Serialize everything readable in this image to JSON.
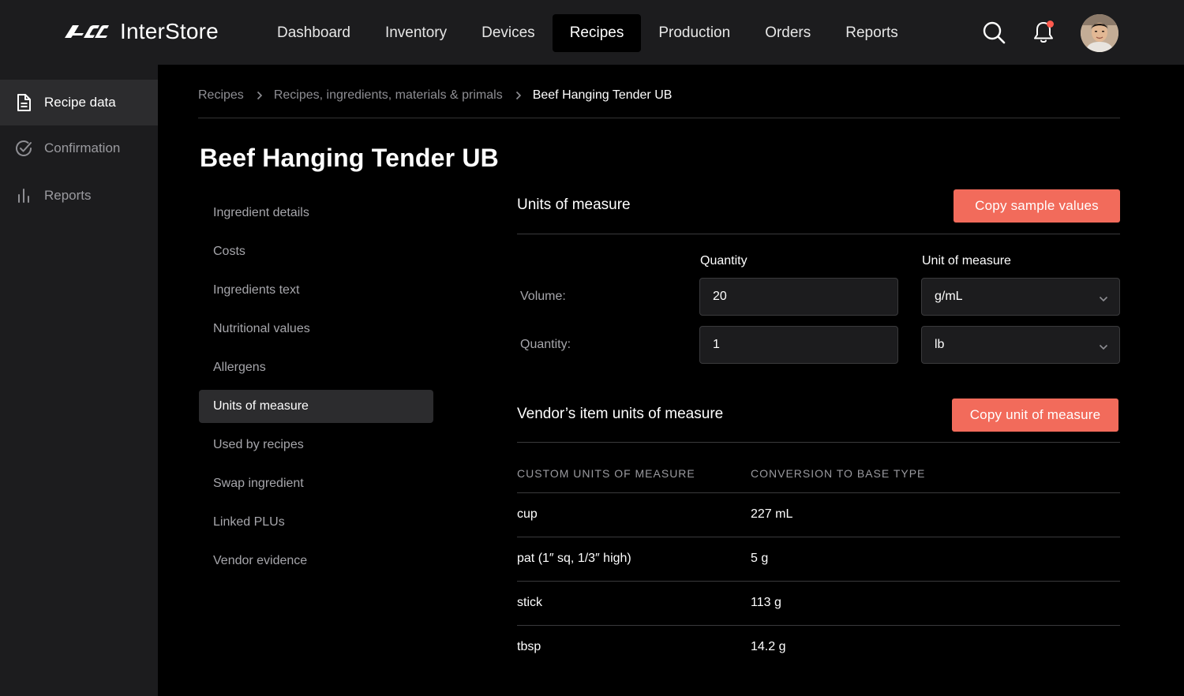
{
  "app": {
    "name": "InterStore"
  },
  "nav": {
    "items": [
      {
        "label": "Dashboard"
      },
      {
        "label": "Inventory"
      },
      {
        "label": "Devices"
      },
      {
        "label": "Recipes"
      },
      {
        "label": "Production"
      },
      {
        "label": "Orders"
      },
      {
        "label": "Reports"
      }
    ],
    "active": "Recipes"
  },
  "header_icons": [
    "search-icon",
    "bell-icon",
    "avatar"
  ],
  "sidebar": {
    "items": [
      {
        "label": "Recipe data",
        "icon": "document-icon"
      },
      {
        "label": "Confirmation",
        "icon": "check-circle-icon"
      },
      {
        "label": "Reports",
        "icon": "bar-chart-icon"
      }
    ],
    "active": "Recipe data"
  },
  "breadcrumb": {
    "items": [
      "Recipes",
      "Recipes, ingredients, materials & primals",
      "Beef Hanging Tender UB"
    ]
  },
  "page": {
    "title": "Beef Hanging Tender UB"
  },
  "subnav": {
    "items": [
      {
        "label": "Ingredient details"
      },
      {
        "label": "Costs"
      },
      {
        "label": "Ingredients text"
      },
      {
        "label": "Nutritional values"
      },
      {
        "label": "Allergens"
      },
      {
        "label": "Units of measure"
      },
      {
        "label": "Used by recipes"
      },
      {
        "label": "Swap ingredient"
      },
      {
        "label": "Linked PLUs"
      },
      {
        "label": "Vendor evidence"
      }
    ],
    "active": "Units of measure"
  },
  "units": {
    "title": "Units of measure",
    "copy_button": "Copy sample values",
    "col_quantity": "Quantity",
    "col_unit": "Unit of measure",
    "rows": [
      {
        "label": "Volume:",
        "quantity": "20",
        "unit": "g/mL"
      },
      {
        "label": "Quantity:",
        "quantity": "1",
        "unit": "lb"
      }
    ]
  },
  "vendor": {
    "title": "Vendor’s item units of measure",
    "copy_button": "Copy unit of measure",
    "headers": [
      "CUSTOM UNITS OF MEASURE",
      "CONVERSION TO BASE TYPE"
    ],
    "rows": [
      {
        "unit": "cup",
        "conversion": "227 mL"
      },
      {
        "unit": "pat (1″ sq, 1/3″ high)",
        "conversion": "5 g"
      },
      {
        "unit": "stick",
        "conversion": "113 g"
      },
      {
        "unit": "tbsp",
        "conversion": "14.2 g"
      }
    ]
  },
  "colors": {
    "accent": "#f26b5b",
    "notification_dot": "#ff5a4e",
    "chrome": "#1c1c1e",
    "background": "#000000"
  }
}
